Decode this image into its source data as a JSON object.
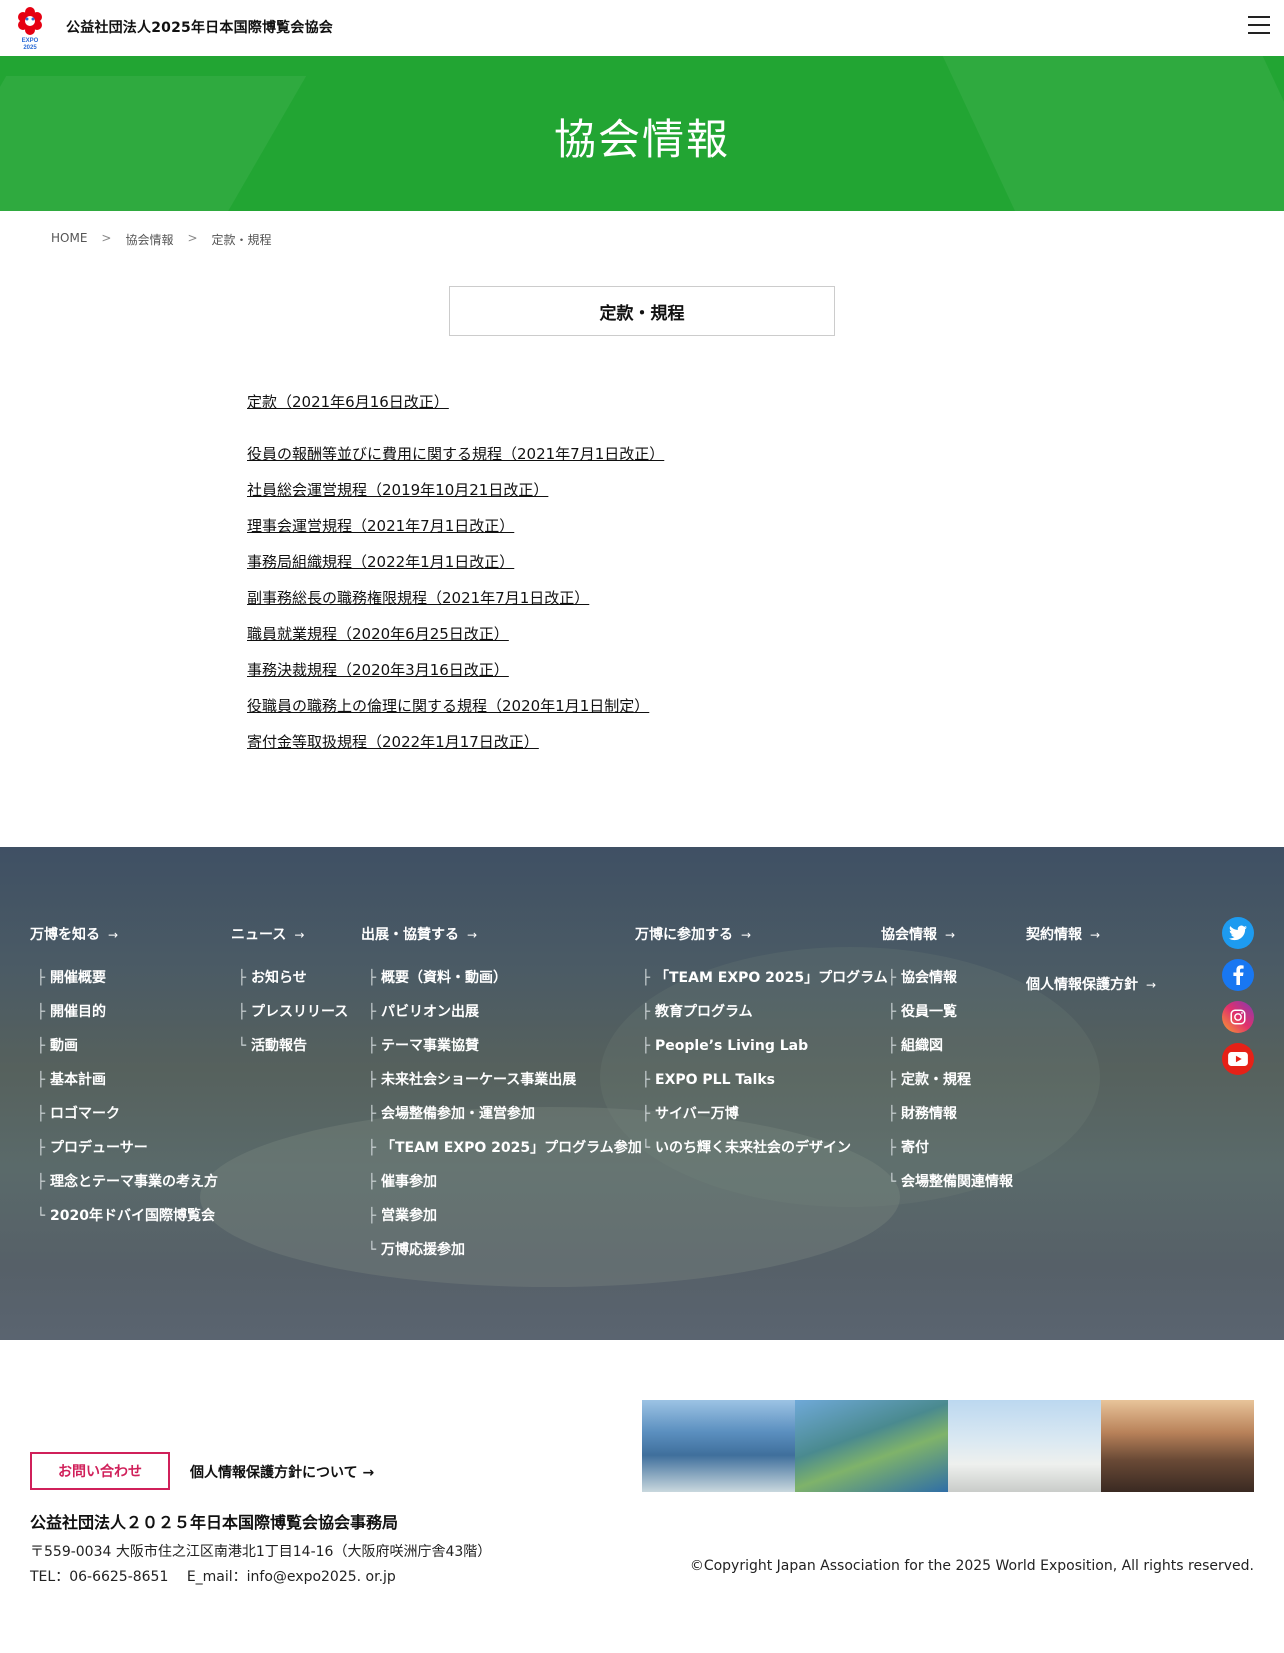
{
  "header": {
    "site_name": "公益社団法人2025年日本国際博覧会協会",
    "logo_text": "EXPO 2025"
  },
  "hero": {
    "title": "協会情報"
  },
  "breadcrumb": {
    "home": "HOME",
    "level1": "協会情報",
    "current": "定款・規程",
    "separator": ">"
  },
  "section_title": "定款・規程",
  "documents": [
    "定款（2021年6月16日改正）",
    "役員の報酬等並びに費用に関する規程（2021年7月1日改正）",
    "社員総会運営規程（2019年10月21日改正）",
    "理事会運営規程（2021年7月1日改正）",
    "事務局組織規程（2022年1月1日改正）",
    "副事務総長の職務権限規程（2021年7月1日改正）",
    "職員就業規程（2020年6月25日改正）",
    "事務決裁規程（2020年3月16日改正）",
    "役職員の職務上の倫理に関する規程（2020年1月1日制定）",
    "寄付金等取扱規程（2022年1月17日改正）"
  ],
  "footer_nav": {
    "col1": {
      "head": "万博を知る",
      "items": [
        "開催概要",
        "開催目的",
        "動画",
        "基本計画",
        "ロゴマーク",
        "プロデューサー",
        "理念とテーマ事業の考え方",
        "2020年ドバイ国際博覧会"
      ]
    },
    "col2": {
      "head": "ニュース",
      "items": [
        "お知らせ",
        "プレスリリース",
        "活動報告"
      ]
    },
    "col3": {
      "head": "出展・協賛する",
      "items": [
        "概要（資料・動画）",
        "パビリオン出展",
        "テーマ事業協賛",
        "未来社会ショーケース事業出展",
        "会場整備参加・運営参加",
        "「TEAM EXPO 2025」プログラム参加",
        "催事参加",
        "営業参加",
        "万博応援参加"
      ]
    },
    "col4": {
      "head": "万博に参加する",
      "items": [
        "「TEAM EXPO 2025」プログラム",
        "教育プログラム",
        "People’s Living Lab",
        "EXPO PLL Talks",
        "サイバー万博",
        "いのち輝く未来社会のデザイン"
      ]
    },
    "col5": {
      "head": "協会情報",
      "items": [
        "協会情報",
        "役員一覧",
        "組織図",
        "定款・規程",
        "財務情報",
        "寄付",
        "会場整備関連情報"
      ]
    },
    "col6": {
      "head": "契約情報",
      "extra": "個人情報保護方針"
    },
    "arrow": "→",
    "tree_mid": "├",
    "tree_end": "└"
  },
  "social": {
    "twitter_color": "#1d9bf0",
    "facebook_color": "#1877f2",
    "instagram_color": "#c13584",
    "youtube_color": "#e62117"
  },
  "footer": {
    "contact_label": "お問い合わせ",
    "privacy_label": "個人情報保護方針について",
    "org_name": "公益社団法人２０２５年日本国際博覧会協会事務局",
    "address": "〒559-0034 大阪市住之江区南港北1丁目14-16（大阪府咲洲庁舎43階）",
    "tel": "TEL：06-6625-8651　 E_mail：info@expo2025. or.jp",
    "copyright": "©Copyright Japan Association for the 2025 World Exposition, All rights reserved."
  },
  "colors": {
    "hero_green": "#22a533",
    "contact_red": "#d0205a"
  }
}
